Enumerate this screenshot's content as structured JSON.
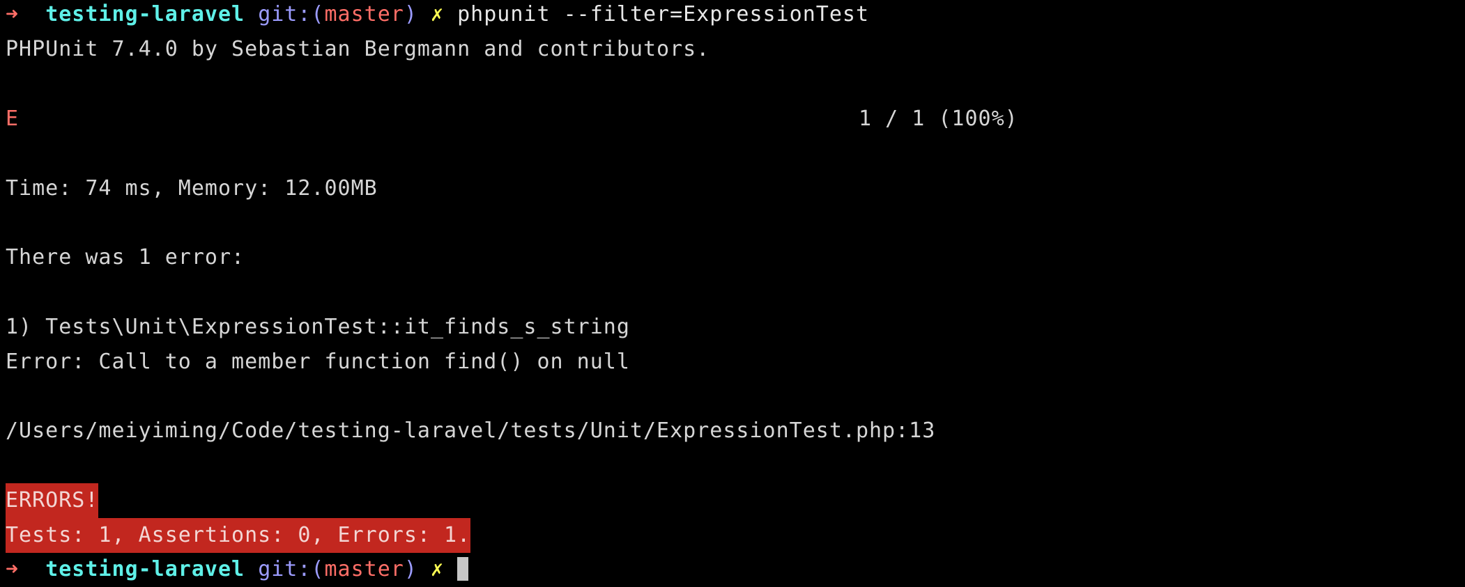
{
  "prompt1": {
    "arrow": "➜",
    "dir": "testing-laravel",
    "git_label": "git:(",
    "branch": "master",
    "git_close": ")",
    "dirty": "✗",
    "command": "phpunit --filter=ExpressionTest"
  },
  "header": "PHPUnit 7.4.0 by Sebastian Bergmann and contributors.",
  "progress": {
    "marks": "E",
    "count": "1 / 1 (100%)"
  },
  "stats": "Time: 74 ms, Memory: 12.00MB",
  "error_summary": "There was 1 error:",
  "error_detail": {
    "test": "1) Tests\\Unit\\ExpressionTest::it_finds_s_string",
    "message": "Error: Call to a member function find() on null",
    "location": "/Users/meiyiming/Code/testing-laravel/tests/Unit/ExpressionTest.php:13"
  },
  "result": {
    "status": "ERRORS!",
    "totals": "Tests: 1, Assertions: 0, Errors: 1."
  },
  "prompt2": {
    "arrow": "➜",
    "dir": "testing-laravel",
    "git_label": "git:(",
    "branch": "master",
    "git_close": ")",
    "dirty": "✗"
  },
  "colors": {
    "background": "#000000",
    "arrow": "#ff6e67",
    "directory": "#5ff0e8",
    "git": "#9c9cff",
    "dirty_marker": "#fdfd53",
    "error_banner": "#c2271f"
  }
}
